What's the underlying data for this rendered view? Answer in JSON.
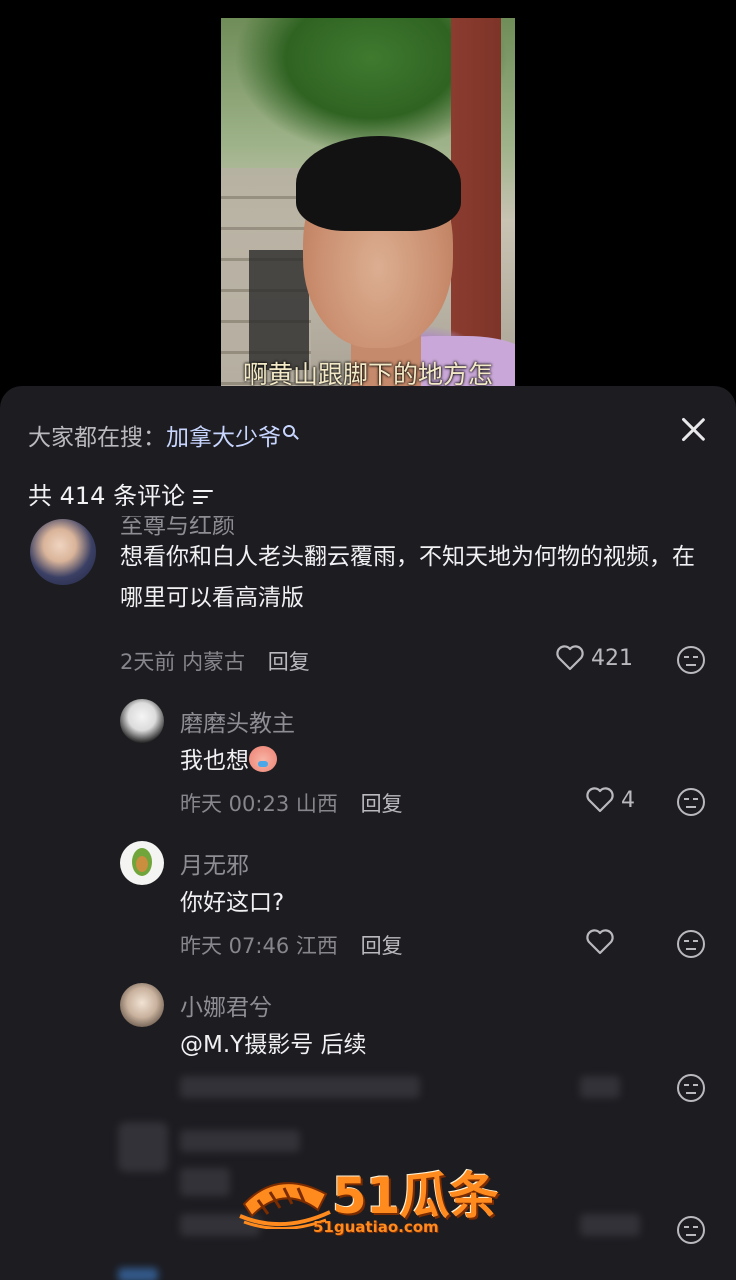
{
  "video": {
    "subtitle": "啊黄山跟脚下的地方怎"
  },
  "sheet": {
    "search_prefix": "大家都在搜：",
    "search_term": "加拿大少爷",
    "comment_count_label": "共 414 条评论"
  },
  "comments": [
    {
      "username": "至尊与红颜",
      "text": "想看你和白人老头翻云覆雨，不知天地为何物的视频，在哪里可以看高清版",
      "time": "2天前",
      "location": "内蒙古",
      "reply_label": "回复",
      "likes": "421"
    },
    {
      "username": "磨磨头教主",
      "text": "我也想",
      "time": "昨天 00:23",
      "location": "山西",
      "reply_label": "回复",
      "likes": "4"
    },
    {
      "username": "月无邪",
      "text": "你好这口?",
      "time": "昨天 07:46",
      "location": "江西",
      "reply_label": "回复",
      "likes": ""
    },
    {
      "username": "小娜君兮",
      "text": "@M.Y摄影号 后续"
    }
  ],
  "watermark": {
    "brand": "51瓜条",
    "url": "51guatiao.com"
  },
  "colors": {
    "sheet_bg": "#1c1c21",
    "link": "#c8d6ff",
    "watermark": "#ff8a1e"
  }
}
